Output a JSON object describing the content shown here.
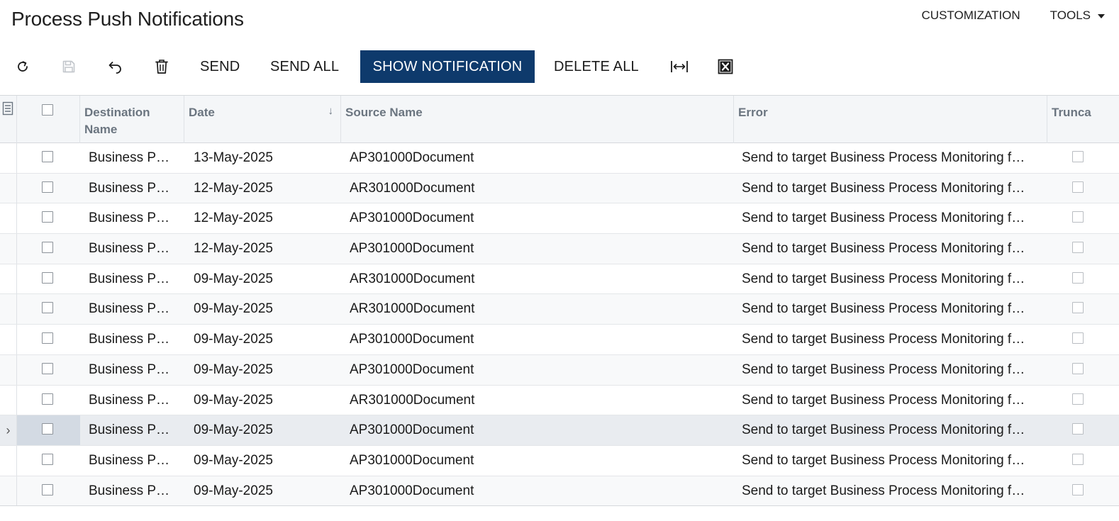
{
  "page": {
    "title": "Process Push Notifications"
  },
  "top_menu": {
    "customization": "CUSTOMIZATION",
    "tools": "TOOLS"
  },
  "toolbar": {
    "refresh_icon": "refresh-icon",
    "save_icon": "save-icon",
    "undo_icon": "undo-icon",
    "delete_icon": "trash-icon",
    "send_label": "SEND",
    "send_all_label": "SEND ALL",
    "show_notification_label": "SHOW NOTIFICATION",
    "delete_all_label": "DELETE ALL",
    "fit_columns_icon": "fit-columns-icon",
    "export_excel_icon": "excel-export-icon",
    "primary_color": "#0e3a6c"
  },
  "grid": {
    "columns": {
      "destination_name": "Destination Name",
      "date": "Date",
      "source_name": "Source Name",
      "error": "Error",
      "truncated": "Trunca"
    },
    "sort": {
      "column": "Date",
      "direction": "descending"
    },
    "rows": [
      {
        "destination": "Business P…",
        "date": "13-May-2025",
        "source": "AP301000Document",
        "error": "Send to target Business Process Monitoring f…",
        "selected": false
      },
      {
        "destination": "Business P…",
        "date": "12-May-2025",
        "source": "AR301000Document",
        "error": "Send to target Business Process Monitoring f…",
        "selected": false
      },
      {
        "destination": "Business P…",
        "date": "12-May-2025",
        "source": "AP301000Document",
        "error": "Send to target Business Process Monitoring f…",
        "selected": false
      },
      {
        "destination": "Business P…",
        "date": "12-May-2025",
        "source": "AP301000Document",
        "error": "Send to target Business Process Monitoring f…",
        "selected": false
      },
      {
        "destination": "Business P…",
        "date": "09-May-2025",
        "source": "AR301000Document",
        "error": "Send to target Business Process Monitoring f…",
        "selected": false
      },
      {
        "destination": "Business P…",
        "date": "09-May-2025",
        "source": "AR301000Document",
        "error": "Send to target Business Process Monitoring f…",
        "selected": false
      },
      {
        "destination": "Business P…",
        "date": "09-May-2025",
        "source": "AP301000Document",
        "error": "Send to target Business Process Monitoring f…",
        "selected": false
      },
      {
        "destination": "Business P…",
        "date": "09-May-2025",
        "source": "AP301000Document",
        "error": "Send to target Business Process Monitoring f…",
        "selected": false
      },
      {
        "destination": "Business P…",
        "date": "09-May-2025",
        "source": "AR301000Document",
        "error": "Send to target Business Process Monitoring f…",
        "selected": false
      },
      {
        "destination": "Business P…",
        "date": "09-May-2025",
        "source": "AP301000Document",
        "error": "Send to target Business Process Monitoring f…",
        "selected": true
      },
      {
        "destination": "Business P…",
        "date": "09-May-2025",
        "source": "AP301000Document",
        "error": "Send to target Business Process Monitoring f…",
        "selected": false
      },
      {
        "destination": "Business P…",
        "date": "09-May-2025",
        "source": "AP301000Document",
        "error": "Send to target Business Process Monitoring f…",
        "selected": false
      }
    ]
  }
}
